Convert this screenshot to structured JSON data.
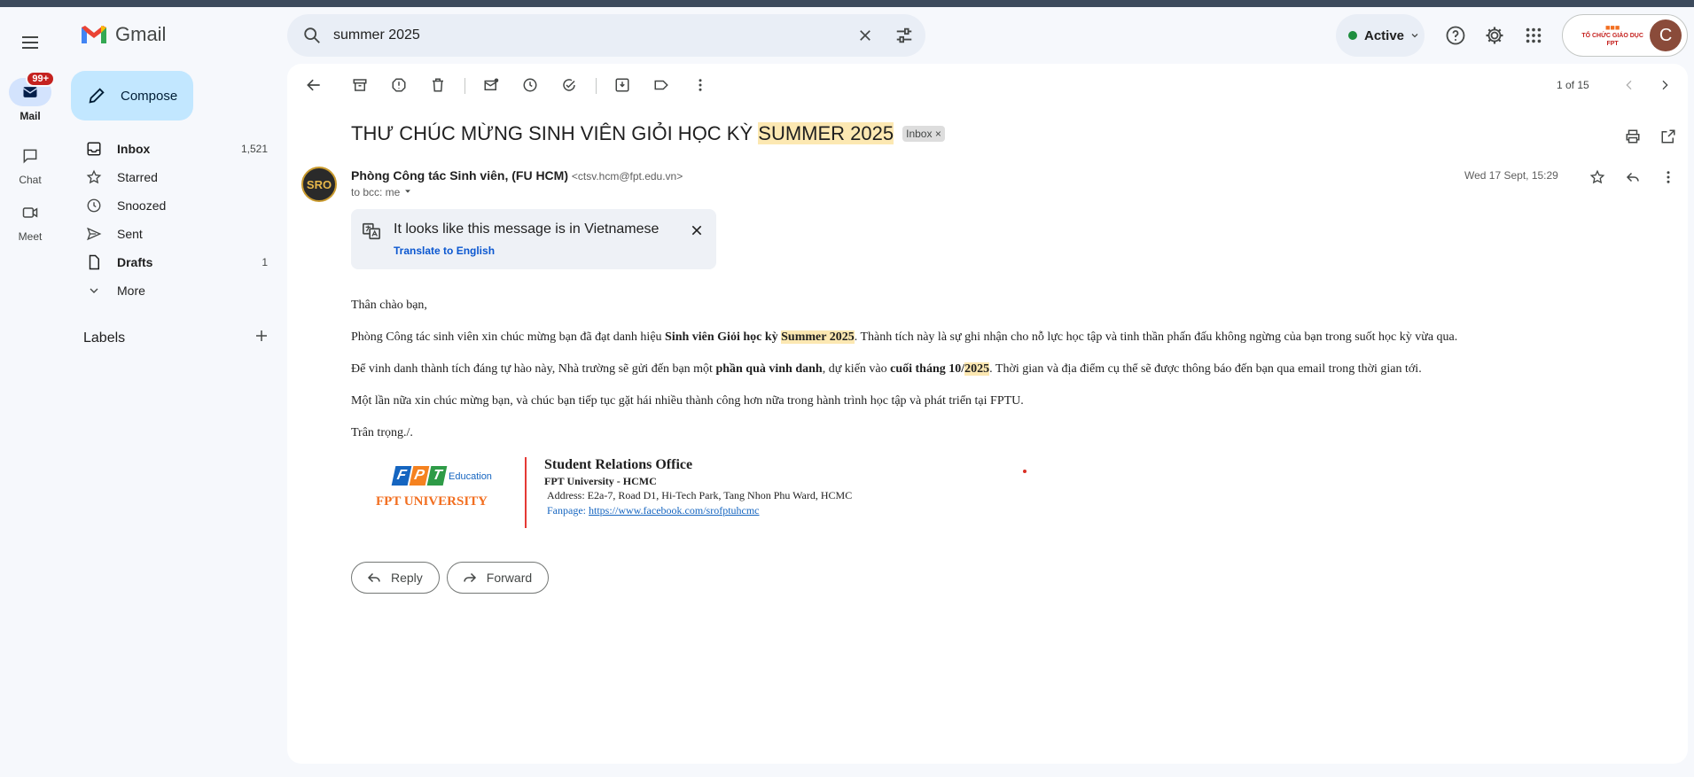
{
  "app": {
    "name": "Gmail"
  },
  "rail": {
    "mail_label": "Mail",
    "mail_badge": "99+",
    "chat_label": "Chat",
    "meet_label": "Meet"
  },
  "search": {
    "value": "summer 2025"
  },
  "status": {
    "label": "Active"
  },
  "account": {
    "org_text": "TỔ CHỨC GIÁO DỤC FPT",
    "avatar_letter": "C"
  },
  "sidebar": {
    "compose_label": "Compose",
    "items": [
      {
        "label": "Inbox",
        "count": "1,521",
        "bold": true
      },
      {
        "label": "Starred",
        "count": ""
      },
      {
        "label": "Snoozed",
        "count": ""
      },
      {
        "label": "Sent",
        "count": ""
      },
      {
        "label": "Drafts",
        "count": "1",
        "bold": true
      },
      {
        "label": "More",
        "count": ""
      }
    ],
    "labels_heading": "Labels"
  },
  "toolbar": {
    "pager": "1 of 15"
  },
  "message": {
    "subject_prefix": "THƯ CHÚC MỪNG SINH VIÊN GIỎI HỌC KỲ ",
    "subject_highlight": "SUMMER 2025",
    "inbox_chip": "Inbox",
    "sender_avatar_text": "SRO",
    "sender_name": "Phòng Công tác Sinh viên, (FU HCM)",
    "sender_email": "<ctsv.hcm@fpt.edu.vn>",
    "to_line": "to bcc: me",
    "date": "Wed 17 Sept, 15:29",
    "translate_text": "It looks like this message is in Vietnamese",
    "translate_link": "Translate to English",
    "greeting": "Thân chào bạn,",
    "p1_a": "Phòng Công tác sinh viên xin chúc mừng bạn đã đạt danh hiệu ",
    "p1_b": "Sinh viên Giỏi học kỳ ",
    "p1_hl": "Summer 2025",
    "p1_c": ". Thành tích này là sự ghi nhận cho nỗ lực học tập và tinh thần phấn đấu không ngừng của bạn trong suốt học kỳ vừa qua.",
    "p2_a": "Để vinh danh thành tích đáng tự hào này, Nhà trường sẽ gửi đến bạn một ",
    "p2_b": "phần quà vinh danh",
    "p2_c": ", dự kiến vào ",
    "p2_d": "cuối tháng 10/",
    "p2_hl": "2025",
    "p2_e": ". Thời gian và địa điểm cụ thể sẽ được thông báo đến bạn qua email trong thời gian tới.",
    "p3": "Một lần nữa xin chúc mừng bạn, và chúc bạn tiếp tục gặt hái nhiều thành công hơn nữa trong hành trình học tập và phát triển tại FPTU.",
    "closing": "Trân trọng./.",
    "sig_logo_small": "Education",
    "sig_logo_big": "FPT UNIVERSITY",
    "sig_title": "Student Relations Office",
    "sig_org": "FPT University - HCMC",
    "sig_address": "Address: E2a-7, Road D1, Hi-Tech Park, Tang Nhon Phu Ward, HCMC",
    "sig_fanpage_label": "Fanpage: ",
    "sig_fanpage_url": "https://www.facebook.com/srofptuhcmc",
    "reply_label": "Reply",
    "forward_label": "Forward"
  },
  "colors": {
    "compose_bg": "#c2e7ff",
    "highlight": "#fce8b2",
    "link": "#0b57d0",
    "badge": "#c5221f"
  }
}
